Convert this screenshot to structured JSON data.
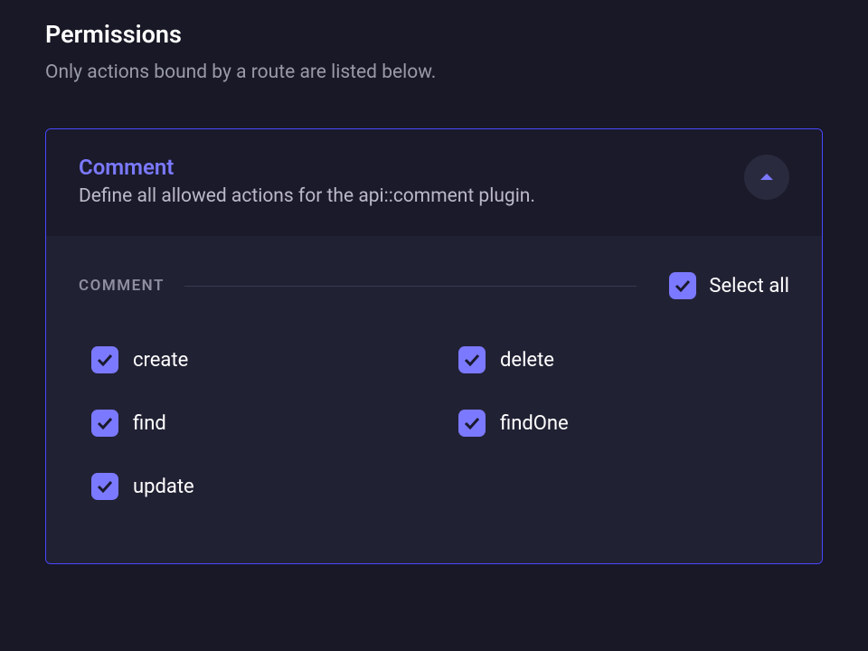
{
  "page": {
    "title": "Permissions",
    "subtitle": "Only actions bound by a route are listed below."
  },
  "panel": {
    "title": "Comment",
    "description": "Define all allowed actions for the api::comment plugin."
  },
  "group": {
    "label": "COMMENT",
    "selectAllLabel": "Select all"
  },
  "actions": [
    {
      "label": "create"
    },
    {
      "label": "delete"
    },
    {
      "label": "find"
    },
    {
      "label": "findOne"
    },
    {
      "label": "update"
    }
  ]
}
